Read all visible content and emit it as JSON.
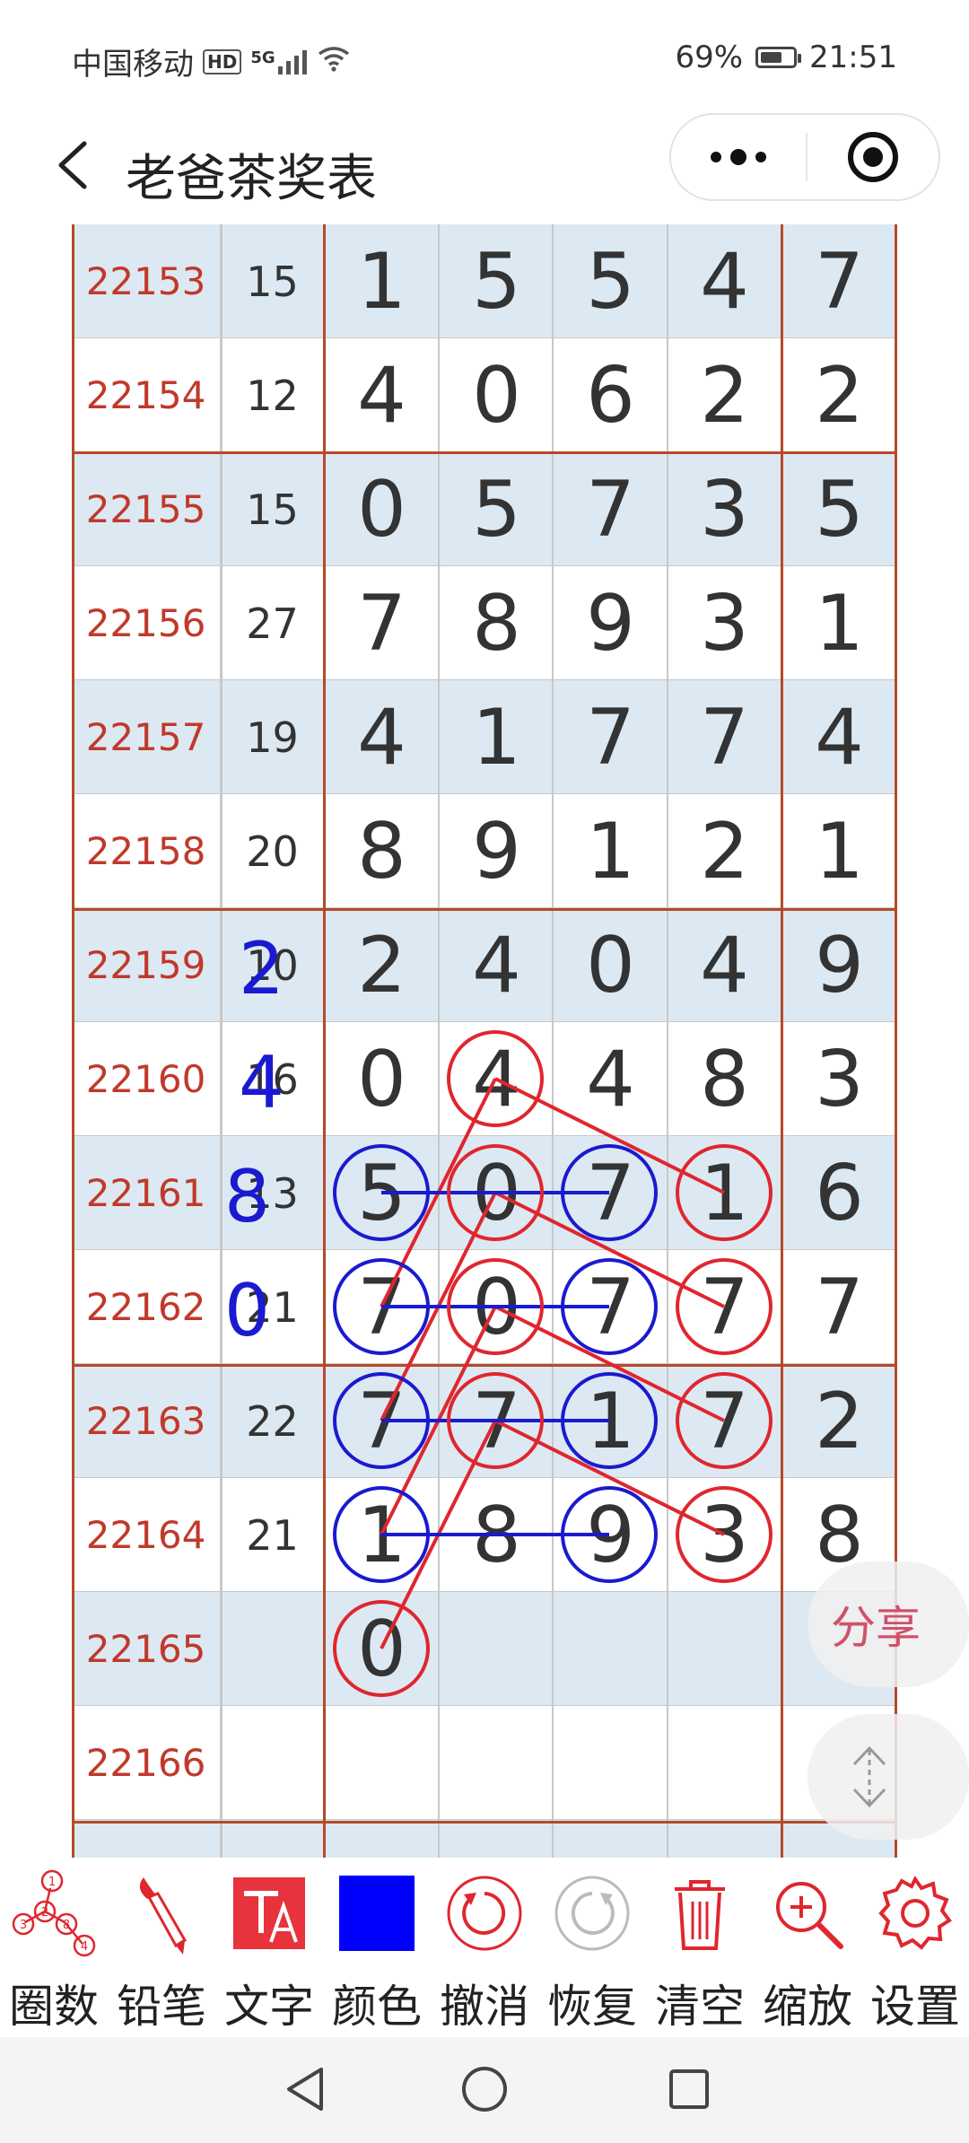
{
  "status_bar": {
    "carrier": "中国移动",
    "hd": "HD",
    "network": "5G",
    "battery_percent": "69%",
    "battery_level": 0.69,
    "time": "21:51"
  },
  "nav": {
    "title": "老爸茶奖表",
    "back_icon": "chevron-left-icon",
    "more_icon": "more-dots-icon",
    "close_icon": "target-close-icon"
  },
  "colors": {
    "issue_red": "#c0392b",
    "grid_brown": "#b54a2a",
    "band_blue": "#dce9f2",
    "circle_red": "#e0262e",
    "circle_blue": "#1a1ad0",
    "note_blue": "#1a1ad0",
    "share_pink": "#d1506a"
  },
  "rows": [
    {
      "issue": "22153",
      "sum": "15",
      "digits": [
        "1",
        "5",
        "5",
        "4",
        "7"
      ]
    },
    {
      "issue": "22154",
      "sum": "12",
      "digits": [
        "4",
        "0",
        "6",
        "2",
        "2"
      ]
    },
    {
      "issue": "22155",
      "sum": "15",
      "digits": [
        "0",
        "5",
        "7",
        "3",
        "5"
      ]
    },
    {
      "issue": "22156",
      "sum": "27",
      "digits": [
        "7",
        "8",
        "9",
        "3",
        "1"
      ]
    },
    {
      "issue": "22157",
      "sum": "19",
      "digits": [
        "4",
        "1",
        "7",
        "7",
        "4"
      ]
    },
    {
      "issue": "22158",
      "sum": "20",
      "digits": [
        "8",
        "9",
        "1",
        "2",
        "1"
      ]
    },
    {
      "issue": "22159",
      "sum": "10",
      "digits": [
        "2",
        "4",
        "0",
        "4",
        "9"
      ]
    },
    {
      "issue": "22160",
      "sum": "16",
      "digits": [
        "0",
        "4",
        "4",
        "8",
        "3"
      ]
    },
    {
      "issue": "22161",
      "sum": "13",
      "digits": [
        "5",
        "0",
        "7",
        "1",
        "6"
      ]
    },
    {
      "issue": "22162",
      "sum": "21",
      "digits": [
        "7",
        "0",
        "7",
        "7",
        "7"
      ]
    },
    {
      "issue": "22163",
      "sum": "22",
      "digits": [
        "7",
        "7",
        "1",
        "7",
        "2"
      ]
    },
    {
      "issue": "22164",
      "sum": "21",
      "digits": [
        "1",
        "8",
        "9",
        "3",
        "8"
      ]
    },
    {
      "issue": "22165",
      "sum": "",
      "digits": [
        "0",
        "",
        "",
        "",
        ""
      ]
    },
    {
      "issue": "22166",
      "sum": "",
      "digits": [
        "",
        "",
        "",
        "",
        ""
      ]
    },
    {
      "issue": "",
      "sum": "",
      "digits": [
        "",
        "",
        "",
        "",
        ""
      ]
    }
  ],
  "annotations": {
    "handwritten": [
      "2",
      "4",
      "8",
      "0"
    ],
    "red_circles": [
      [
        7,
        1
      ],
      [
        8,
        1
      ],
      [
        8,
        3
      ],
      [
        9,
        1
      ],
      [
        9,
        3
      ],
      [
        10,
        1
      ],
      [
        10,
        3
      ],
      [
        11,
        3
      ],
      [
        12,
        0
      ]
    ],
    "blue_circles": [
      [
        8,
        0
      ],
      [
        8,
        2
      ],
      [
        9,
        0
      ],
      [
        9,
        2
      ],
      [
        10,
        0
      ],
      [
        10,
        2
      ],
      [
        11,
        0
      ],
      [
        11,
        2
      ]
    ],
    "red_lines": [
      [
        [
          7,
          1
        ],
        [
          8,
          3
        ]
      ],
      [
        [
          8,
          1
        ],
        [
          9,
          3
        ]
      ],
      [
        [
          9,
          1
        ],
        [
          10,
          3
        ]
      ],
      [
        [
          10,
          1
        ],
        [
          11,
          3
        ]
      ],
      [
        [
          7,
          1
        ],
        [
          9,
          0
        ]
      ],
      [
        [
          8,
          1
        ],
        [
          10,
          0
        ]
      ],
      [
        [
          9,
          1
        ],
        [
          11,
          0
        ]
      ],
      [
        [
          10,
          1
        ],
        [
          12,
          0
        ]
      ]
    ],
    "blue_lines": [
      [
        [
          8,
          0
        ],
        [
          8,
          2
        ]
      ],
      [
        [
          9,
          0
        ],
        [
          9,
          2
        ]
      ],
      [
        [
          10,
          0
        ],
        [
          10,
          2
        ]
      ],
      [
        [
          11,
          0
        ],
        [
          11,
          2
        ]
      ]
    ]
  },
  "share_label": "分享",
  "scroll_icon": "up-down-arrows-icon",
  "toolbar": [
    {
      "label": "圈数",
      "icon": "circle-numbers-icon"
    },
    {
      "label": "铅笔",
      "icon": "brush-icon"
    },
    {
      "label": "文字",
      "icon": "text-tool-icon"
    },
    {
      "label": "颜色",
      "icon": "color-swatch-icon",
      "color": "#0000ff"
    },
    {
      "label": "撤消",
      "icon": "undo-icon"
    },
    {
      "label": "恢复",
      "icon": "redo-icon"
    },
    {
      "label": "清空",
      "icon": "trash-icon"
    },
    {
      "label": "缩放",
      "icon": "zoom-in-icon"
    },
    {
      "label": "设置",
      "icon": "gear-icon"
    }
  ],
  "system_nav": {
    "back": "triangle-back-icon",
    "home": "circle-home-icon",
    "recents": "square-recents-icon"
  }
}
